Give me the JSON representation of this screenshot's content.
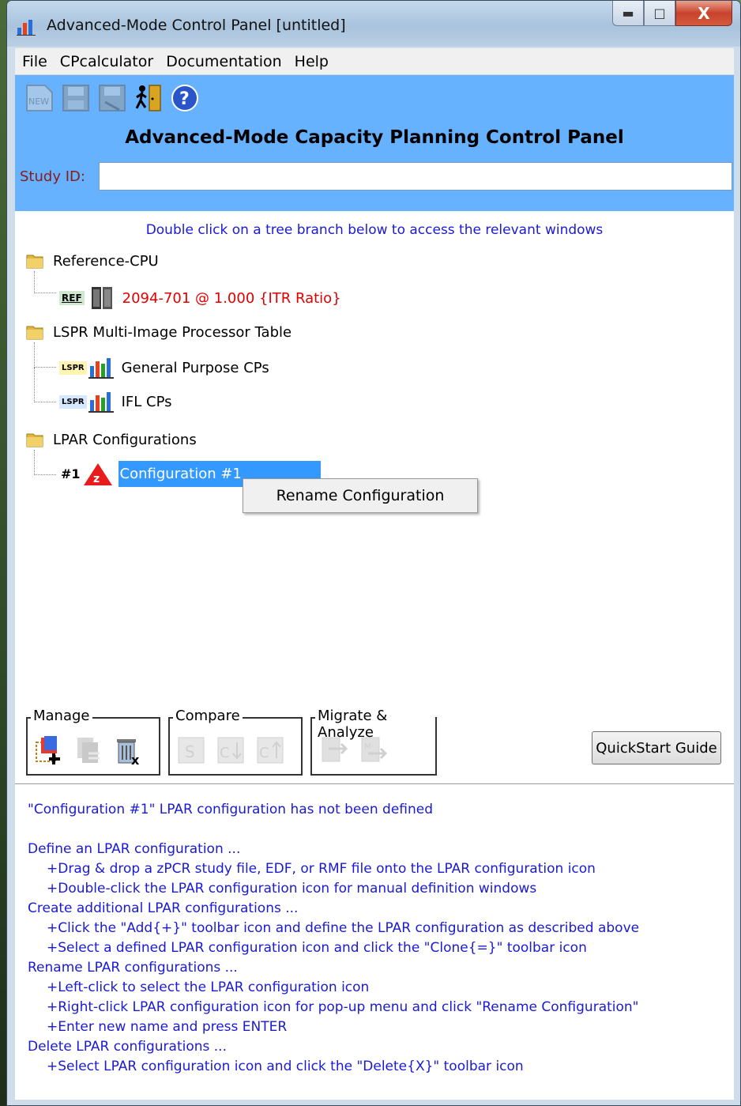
{
  "window": {
    "title": "Advanced-Mode Control Panel [untitled]",
    "minimize": "▬",
    "maximize": "□",
    "close": "X"
  },
  "menu": [
    "File",
    "CPcalculator",
    "Documentation",
    "Help"
  ],
  "toolbar": {
    "icons": [
      "new-icon",
      "save-icon",
      "save-as-icon",
      "exit-icon",
      "help-icon"
    ],
    "new_label": "NEW"
  },
  "header": {
    "title": "Advanced-Mode Capacity Planning Control Panel",
    "study_label": "Study ID:",
    "study_value": ""
  },
  "tree": {
    "hint": "Double click on a tree branch below to access the relevant windows",
    "reference": {
      "folder": "Reference-CPU",
      "badge": "REF",
      "item": "2094-701 @ 1.000 {ITR Ratio}"
    },
    "lspr": {
      "folder": "LSPR Multi-Image Processor Table",
      "badge": "LSPR",
      "items": [
        "General Purpose CPs",
        "IFL CPs"
      ]
    },
    "lpar": {
      "folder": "LPAR Configurations",
      "number": "#1",
      "item": "Configuration #1"
    },
    "context_menu": "Rename Configuration"
  },
  "groups": {
    "manage": "Manage",
    "compare": "Compare",
    "migrate": "Migrate & Analyze",
    "quickstart": "QuickStart Guide"
  },
  "status": {
    "line1": "\"Configuration #1\" LPAR configuration has not been defined",
    "line2": "Define an LPAR configuration ...",
    "line3": "+Drag & drop a zPCR study file, EDF, or RMF file onto the LPAR configuration icon",
    "line4": "+Double-click the LPAR configuration icon for manual definition windows",
    "line5": "Create additional LPAR configurations ...",
    "line6": "+Click the \"Add{+}\" toolbar icon and define the LPAR configuration as described above",
    "line7": "+Select a defined LPAR configuration icon and click the \"Clone{=}\" toolbar icon",
    "line8": "Rename LPAR configurations ...",
    "line9": "+Left-click to select the LPAR configuration icon",
    "line10": "+Right-click LPAR configuration icon for pop-up menu and click \"Rename Configuration\"",
    "line11": "+Enter new name and press ENTER",
    "line12": "Delete LPAR configurations ...",
    "line13": "+Select LPAR configuration icon and click the \"Delete{X}\" toolbar icon"
  },
  "colors": {
    "header_bg": "#66b2ff",
    "hint_text": "#1a1ad6",
    "reference_text": "#e00000",
    "selection": "#3399ff"
  }
}
